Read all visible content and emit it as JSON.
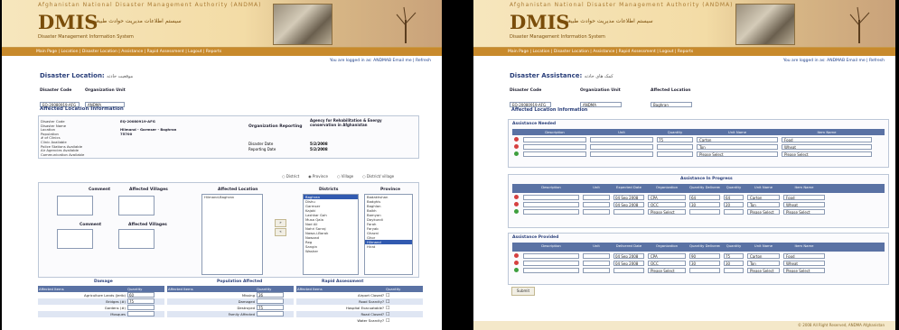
{
  "app": {
    "agency": "Afghanistan National Disaster Management Authority (ANDMA)",
    "logo": "DMIS",
    "logo_dari": "سیستم اطلاعات مدیریت حوادث طبیعی",
    "subtitle": "Disaster Management Information System"
  },
  "left": {
    "nav": "Main Page | Location | Disaster Location | Assistance | Rapid Assessment | Logout | Reports",
    "user": {
      "prefix": "You are logged in as:",
      "name": "ANDMAB",
      "links": "Email me | Refresh"
    },
    "page_title": "Disaster Location:",
    "page_title_dari": "موقعیت حادثه",
    "disaster_code_label": "Disaster Code",
    "disaster_code_value": "EQ-20080919-AFG",
    "org_unit_label": "Organization Unit",
    "org_unit_value": "ANDMA",
    "affected_info_title": "Affected Location Information",
    "info": [
      {
        "label": "Disaster Code",
        "value": "EQ-20080919-AFG"
      },
      {
        "label": "Disaster Name",
        "value": ""
      },
      {
        "label": "Location",
        "value": "Hilmand - Garmser - Baghran"
      },
      {
        "label": "Population",
        "value": "75700"
      },
      {
        "label": "# of Clinics",
        "value": ""
      },
      {
        "label": "Clinic Available",
        "value": ""
      },
      {
        "label": "Police Stations Available",
        "value": ""
      },
      {
        "label": "Air Agencies Available",
        "value": ""
      },
      {
        "label": "Communication Available",
        "value": ""
      }
    ],
    "org_reporting_label": "Organization Reporting",
    "org_reporting_value": "Agency for Rehabilitation & Energy conservation in Afghanistan",
    "disaster_date_label": "Disaster Date",
    "disaster_date_value": "5/2/2008",
    "reporting_date_label": "Reporting Date",
    "reporting_date_value": "5/2/2008",
    "radio": [
      "District",
      "Province",
      "Village",
      "District/ village"
    ],
    "columns": {
      "province": "Province",
      "districts": "Districts",
      "affected_location": "Affected Location",
      "affected_villages": "Affected Villages",
      "comment": "Comment"
    },
    "province_list": [
      "Badakhshan",
      "Badghis",
      "Baghlan",
      "Balkh",
      "Bamyan",
      "Daykundi",
      "Farah",
      "Faryab",
      "Ghazni",
      "Ghor",
      "Hilmand",
      "Hirat"
    ],
    "district_list": [
      "Baghran",
      "Dishu",
      "Garmser",
      "Kajaki",
      "Lashkar Gah",
      "Musa Qala",
      "Nad Ali",
      "Nahri Sarraj",
      "Nawa-i-Barak",
      "Nawzad",
      "Reg",
      "Sangin",
      "Washer"
    ],
    "affected_list": [
      "Hilmand-Baghran"
    ],
    "add_btn": "»",
    "remove_btn": "«",
    "damage_title": "Damage",
    "population_title": "Population Affected",
    "rapid_title": "Rapid Assessment",
    "damage_head": [
      "Affected Items",
      "Quantity"
    ],
    "damage_rows": [
      {
        "item": "Agriculture Lands (Jerib)",
        "qty": "60"
      },
      {
        "item": "Bridges (#)",
        "qty": "75"
      },
      {
        "item": "Gardens (#)",
        "qty": ""
      },
      {
        "item": "Mosques",
        "qty": ""
      }
    ],
    "population_rows": [
      {
        "item": "Missing",
        "qty": "36"
      },
      {
        "item": "Damaged",
        "qty": ""
      },
      {
        "item": "Destroyed",
        "qty": "75"
      },
      {
        "item": "Family Affected",
        "qty": ""
      }
    ],
    "rapid_rows": [
      {
        "item": "Airport Closed?"
      },
      {
        "item": "Road Scarcity?"
      },
      {
        "item": "Hospital Evacuatable?"
      },
      {
        "item": "Road Closed?"
      },
      {
        "item": "Water Scarcity?"
      }
    ]
  },
  "right": {
    "nav": "Main Page | Location | Disaster Location | Assistance | Rapid Assessment | Logout | Reports",
    "user": {
      "prefix": "You are logged in as:",
      "name": "ANDMAB",
      "links": "Email me | Refresh"
    },
    "page_title": "Disaster Assistance:",
    "page_title_dari": "کمک های حادثه",
    "disaster_code_label": "Disaster Code",
    "disaster_code_value": "EQ-20080919-AFG",
    "org_unit_label": "Organization Unit",
    "org_unit_value": "ANDMA",
    "affected_loc_label": "Affected Location",
    "affected_loc_value": "Baghran",
    "affected_info_title": "Affected Location Information",
    "needed_title": "Assistance Needed",
    "needed_head": [
      "Item Name",
      "Quantity",
      "Unit Name",
      "Unit",
      "Description"
    ],
    "needed_rows": [
      {
        "item": "Food",
        "unit": "Carton",
        "qty": "75"
      },
      {
        "item": "Wheat",
        "unit": "Ton",
        "qty": ""
      },
      {
        "item": "Please Select",
        "unit": "Please Select",
        "qty": ""
      }
    ],
    "progress_title": "Assistance In Progress",
    "progress_head": [
      "Item Name",
      "Unit Name",
      "Quantity",
      "Quantity Delivered",
      "Organization",
      "Expected Date",
      "Unit Amount",
      "Description"
    ],
    "progress_rows": [
      {
        "item": "Food",
        "unit": "Carton",
        "qty": "64",
        "deliv": "64",
        "org": "CPA",
        "date": "04 Sep 2008"
      },
      {
        "item": "Wheat",
        "unit": "Ton",
        "qty": "20",
        "deliv": "30",
        "org": "OCC",
        "date": "04 Sep 2008"
      },
      {
        "item": "Please Select",
        "unit": "Please Select",
        "qty": "",
        "deliv": "",
        "org": "Please Select",
        "date": ""
      }
    ],
    "provided_title": "Assistance Provided",
    "provided_head": [
      "Item Name",
      "Unit Name",
      "Quantity",
      "Quantity Delivered",
      "Organization",
      "Delivered Date",
      "Unit Amount",
      "Description"
    ],
    "provided_rows": [
      {
        "item": "Food",
        "unit": "Carton",
        "qty": "75",
        "deliv": "90",
        "org": "CPA",
        "date": "04 Sep 2008"
      },
      {
        "item": "Wheat",
        "unit": "Ton",
        "qty": "30",
        "deliv": "30",
        "org": "OCC",
        "date": "04 Sep 2008"
      },
      {
        "item": "Please Select",
        "unit": "Please Select",
        "qty": "",
        "deliv": "",
        "org": "Please Select",
        "date": ""
      }
    ],
    "submit": "Submit",
    "footer": "© 2008 All Right Reserved, ANDMA Afghanistan"
  }
}
